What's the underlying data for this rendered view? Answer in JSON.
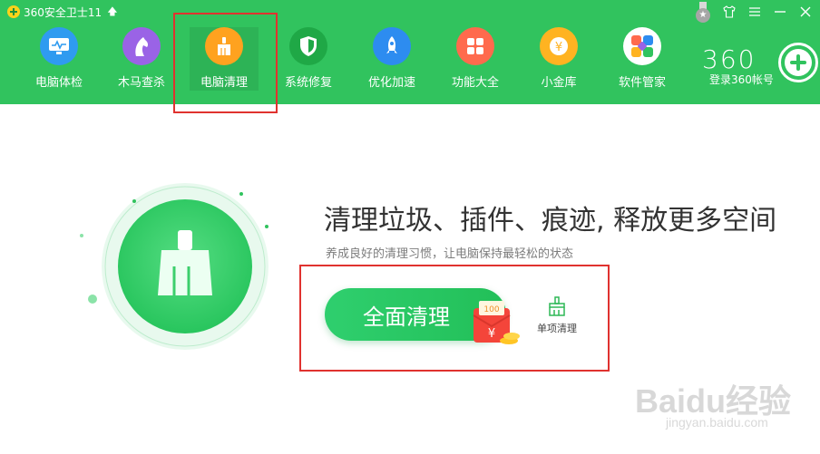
{
  "window": {
    "title": "360安全卫士11",
    "controls": {
      "medal_icon": "medal-icon",
      "skin_icon": "shirt-icon",
      "menu_icon": "menu-icon",
      "minimize_icon": "minimize-icon",
      "close_icon": "close-icon"
    }
  },
  "nav": {
    "items": [
      {
        "label": "电脑体检",
        "icon": "monitor-pulse-icon",
        "color": "#2f9bf0"
      },
      {
        "label": "木马查杀",
        "icon": "horse-icon",
        "color": "#9a63e6"
      },
      {
        "label": "电脑清理",
        "icon": "broom-icon",
        "color": "#ffa21f"
      },
      {
        "label": "系统修复",
        "icon": "shield-icon",
        "color": "#1fa846"
      },
      {
        "label": "优化加速",
        "icon": "rocket-icon",
        "color": "#2d8cf0"
      },
      {
        "label": "功能大全",
        "icon": "grid-icon",
        "color": "#ff6a4d"
      },
      {
        "label": "小金库",
        "icon": "coin-yen-icon",
        "color": "#ffb321"
      },
      {
        "label": "软件管家",
        "icon": "apps-flower-icon",
        "color": "#ffffff"
      }
    ],
    "active_index": 2
  },
  "account": {
    "brand": "360",
    "login_label": "登录360帐号"
  },
  "main": {
    "headline": "清理垃圾、插件、痕迹, 释放更多空间",
    "subtitle": "养成良好的清理习惯，让电脑保持最轻松的状态",
    "primary_button": "全面清理",
    "redpacket_amount": "100",
    "redpacket_symbol": "¥",
    "secondary_button": "单项清理"
  },
  "watermark": {
    "brand": "Baidu经验",
    "url": "jingyan.baidu.com"
  },
  "colors": {
    "header_green": "#31c35e",
    "highlight_red": "#e0322f"
  }
}
